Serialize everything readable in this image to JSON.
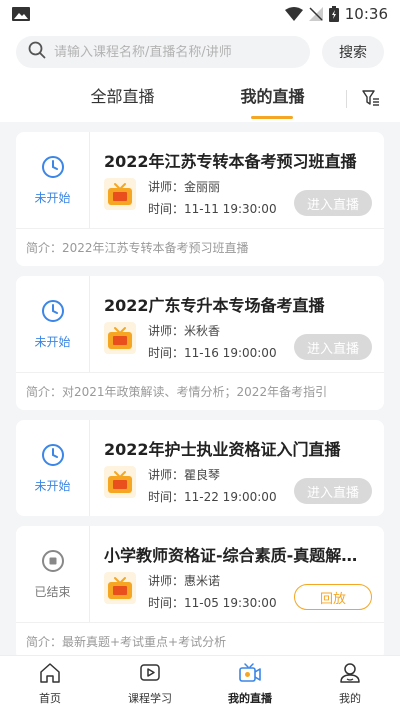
{
  "status_bar": {
    "time": "10:36"
  },
  "search": {
    "placeholder": "请输入课程名称/直播名称/讲师",
    "button_label": "搜索"
  },
  "tabs": [
    {
      "label": "全部直播"
    },
    {
      "label": "我的直播"
    }
  ],
  "colors": {
    "accent": "#f5a623",
    "status_blue": "#3b86e6",
    "disabled": "#d9d9d9"
  },
  "cards": [
    {
      "status": "未开始",
      "title": "2022年江苏专转本备考预习班直播",
      "teacher": "讲师：金丽丽",
      "time": "时间：11-11 19:30:00",
      "action": "进入直播",
      "intro": "简介：2022年江苏专转本备考预习班直播"
    },
    {
      "status": "未开始",
      "title": "2022广东专升本专场备考直播",
      "teacher": "讲师：米秋香",
      "time": "时间：11-16 19:00:00",
      "action": "进入直播",
      "intro": "简介：对2021年政策解读、考情分析；2022年备考指引"
    },
    {
      "status": "未开始",
      "title": "2022年护士执业资格证入门直播",
      "teacher": "讲师：瞿良琴",
      "time": "时间：11-22 19:00:00",
      "action": "进入直播",
      "intro": ""
    },
    {
      "status": "已结束",
      "title": "小学教师资格证-综合素质-真题解析...",
      "teacher": "讲师：惠米诺",
      "time": "时间：11-05 19:30:00",
      "action": "回放",
      "intro": "简介：最新真题+考试重点+考试分析"
    }
  ],
  "bottom_nav": [
    {
      "label": "首页",
      "icon": "home-icon"
    },
    {
      "label": "课程学习",
      "icon": "play-icon"
    },
    {
      "label": "我的直播",
      "icon": "live-camera-icon"
    },
    {
      "label": "我的",
      "icon": "user-icon"
    }
  ]
}
